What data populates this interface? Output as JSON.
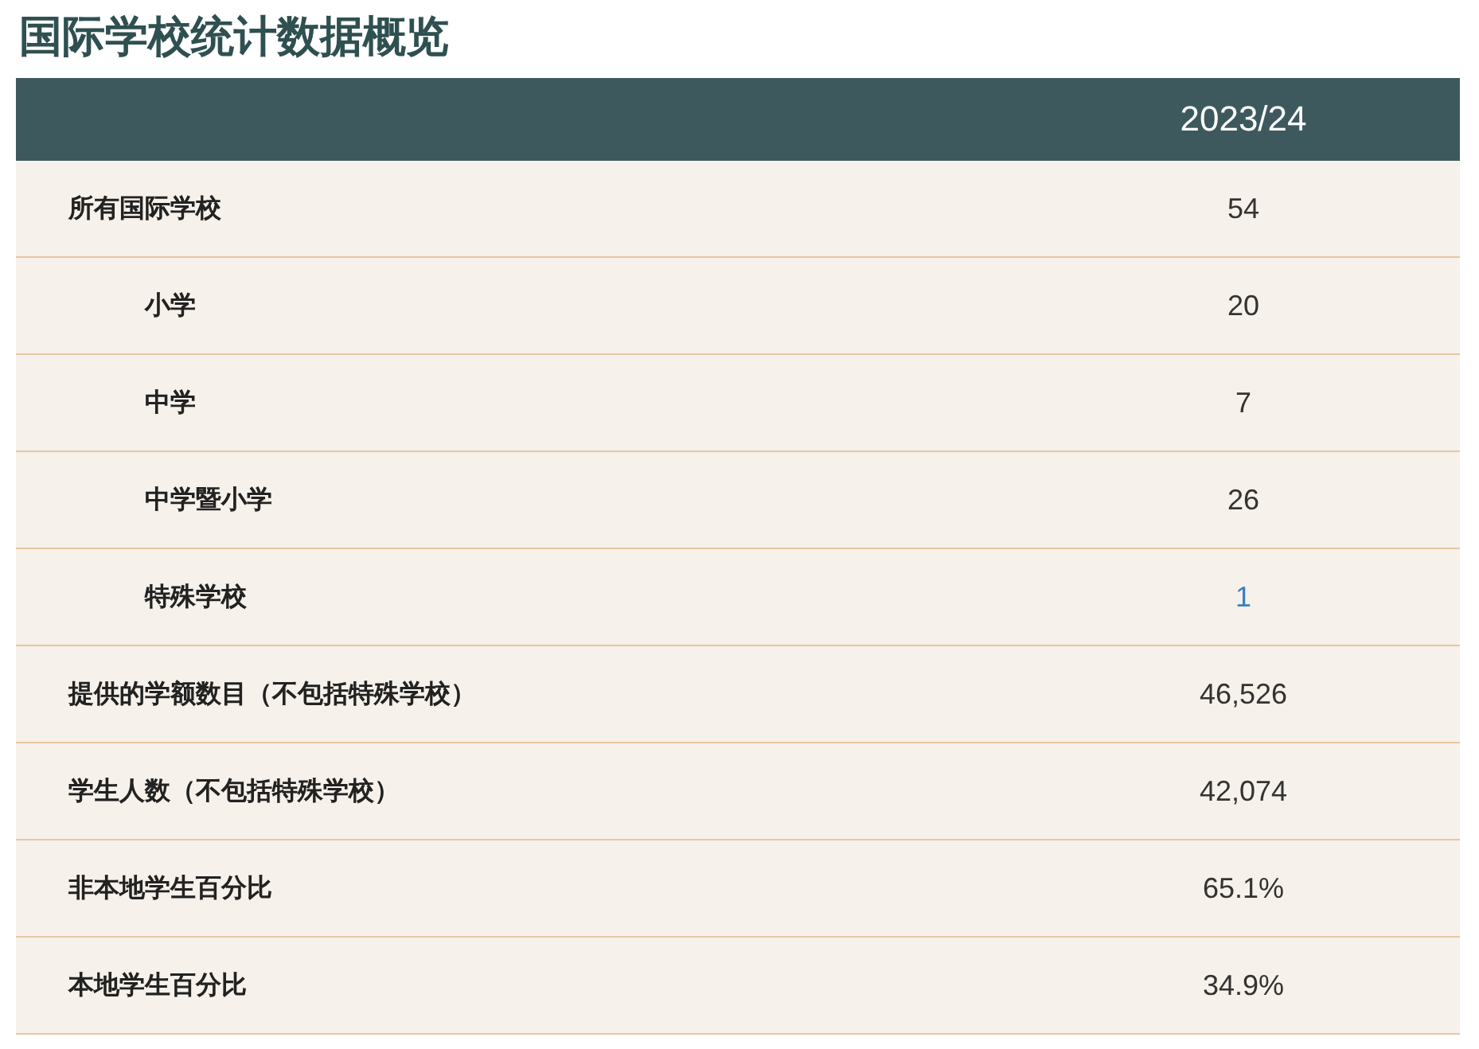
{
  "title": "国际学校统计数据概览",
  "table": {
    "columns": [
      "2023/24"
    ],
    "rows": [
      {
        "label": "所有国际学校",
        "value": "54",
        "link": false,
        "children": [
          {
            "label": "小学",
            "value": "20",
            "link": false
          },
          {
            "label": "中学",
            "value": "7",
            "link": false
          },
          {
            "label": "中学暨小学",
            "value": "26",
            "link": false
          },
          {
            "label": "特殊学校",
            "value": "1",
            "link": true
          }
        ]
      },
      {
        "label": "提供的学额数目（不包括特殊学校）",
        "value": "46,526",
        "link": false
      },
      {
        "label": "学生人数（不包括特殊学校）",
        "value": "42,074",
        "link": false
      },
      {
        "label": "非本地学生百分比",
        "value": "65.1%",
        "link": false
      },
      {
        "label": "本地学生百分比",
        "value": "34.9%",
        "link": false
      }
    ]
  }
}
